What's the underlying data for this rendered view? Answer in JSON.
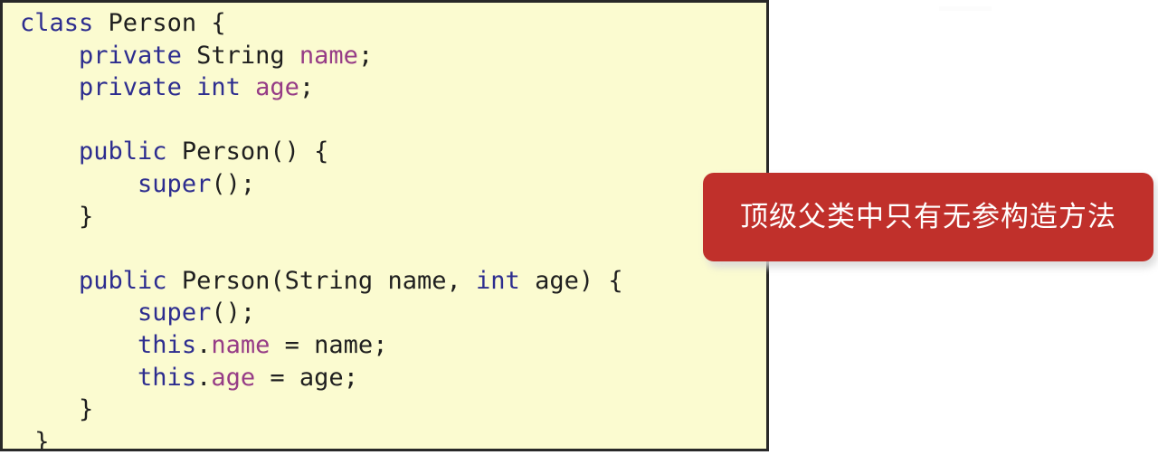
{
  "code_panel": {
    "language": "java",
    "background_color": "#fbfbd0",
    "border_color": "#282828",
    "lines": [
      [
        {
          "t": "class",
          "c": "kw"
        },
        {
          "t": " ",
          "c": "punc"
        },
        {
          "t": "Person",
          "c": "type"
        },
        {
          "t": " {",
          "c": "punc"
        }
      ],
      [
        {
          "t": "    ",
          "c": "punc"
        },
        {
          "t": "private",
          "c": "kw"
        },
        {
          "t": " ",
          "c": "punc"
        },
        {
          "t": "String",
          "c": "type"
        },
        {
          "t": " ",
          "c": "punc"
        },
        {
          "t": "name",
          "c": "field"
        },
        {
          "t": ";",
          "c": "punc"
        }
      ],
      [
        {
          "t": "    ",
          "c": "punc"
        },
        {
          "t": "private",
          "c": "kw"
        },
        {
          "t": " ",
          "c": "punc"
        },
        {
          "t": "int",
          "c": "kw"
        },
        {
          "t": " ",
          "c": "punc"
        },
        {
          "t": "age",
          "c": "field"
        },
        {
          "t": ";",
          "c": "punc"
        }
      ],
      [],
      [
        {
          "t": "    ",
          "c": "punc"
        },
        {
          "t": "public",
          "c": "kw"
        },
        {
          "t": " ",
          "c": "punc"
        },
        {
          "t": "Person",
          "c": "type"
        },
        {
          "t": "() {",
          "c": "punc"
        }
      ],
      [
        {
          "t": "        ",
          "c": "punc"
        },
        {
          "t": "super",
          "c": "kw"
        },
        {
          "t": "();",
          "c": "punc"
        }
      ],
      [
        {
          "t": "    }",
          "c": "punc"
        }
      ],
      [],
      [
        {
          "t": "    ",
          "c": "punc"
        },
        {
          "t": "public",
          "c": "kw"
        },
        {
          "t": " ",
          "c": "punc"
        },
        {
          "t": "Person",
          "c": "type"
        },
        {
          "t": "(",
          "c": "punc"
        },
        {
          "t": "String",
          "c": "type"
        },
        {
          "t": " ",
          "c": "punc"
        },
        {
          "t": "name",
          "c": "id"
        },
        {
          "t": ", ",
          "c": "punc"
        },
        {
          "t": "int",
          "c": "kw"
        },
        {
          "t": " ",
          "c": "punc"
        },
        {
          "t": "age",
          "c": "id"
        },
        {
          "t": ") {",
          "c": "punc"
        }
      ],
      [
        {
          "t": "        ",
          "c": "punc"
        },
        {
          "t": "super",
          "c": "kw"
        },
        {
          "t": "();",
          "c": "punc"
        }
      ],
      [
        {
          "t": "        ",
          "c": "punc"
        },
        {
          "t": "this",
          "c": "kw"
        },
        {
          "t": ".",
          "c": "punc"
        },
        {
          "t": "name",
          "c": "field"
        },
        {
          "t": " = ",
          "c": "punc"
        },
        {
          "t": "name",
          "c": "id"
        },
        {
          "t": ";",
          "c": "punc"
        }
      ],
      [
        {
          "t": "        ",
          "c": "punc"
        },
        {
          "t": "this",
          "c": "kw"
        },
        {
          "t": ".",
          "c": "punc"
        },
        {
          "t": "age",
          "c": "field"
        },
        {
          "t": " = ",
          "c": "punc"
        },
        {
          "t": "age",
          "c": "id"
        },
        {
          "t": ";",
          "c": "punc"
        }
      ],
      [
        {
          "t": "    }",
          "c": "punc"
        }
      ],
      [
        {
          "t": " }",
          "c": "punc"
        }
      ]
    ],
    "plain_text": "class Person {\n    private String name;\n    private int age;\n\n    public Person() {\n        super();\n    }\n\n    public Person(String name, int age) {\n        super();\n        this.name = name;\n        this.age = age;\n    }\n }"
  },
  "callout": {
    "text": "顶级父类中只有无参构造方法",
    "background_color": "#c0302b",
    "text_color": "#ffffff"
  }
}
